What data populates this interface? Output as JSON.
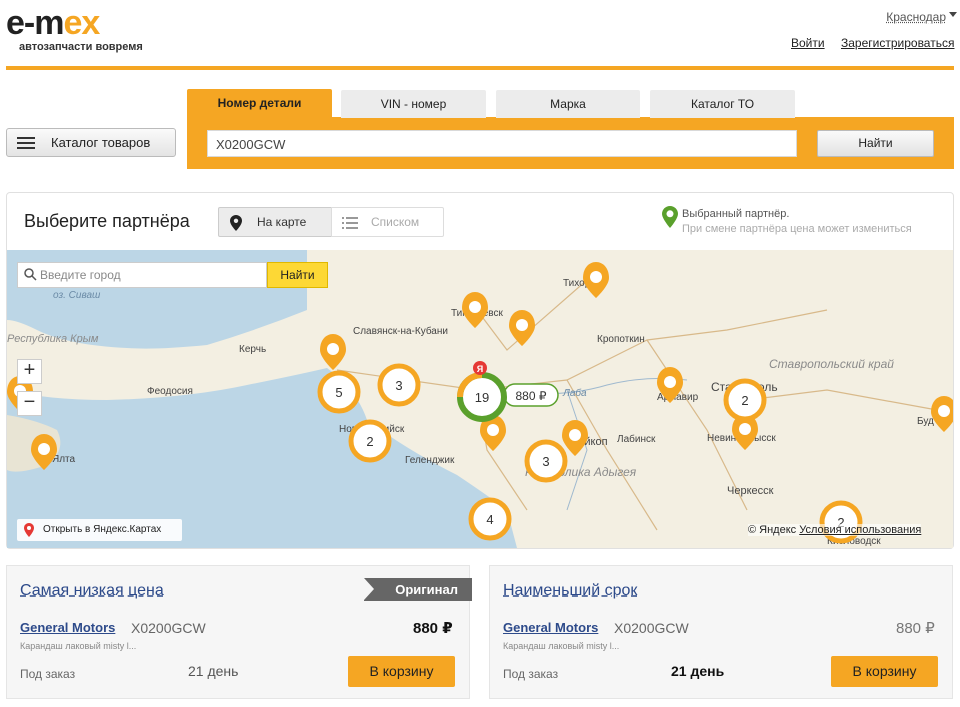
{
  "header": {
    "logo_left": "e-m",
    "logo_right": "ex",
    "tagline": "автозапчасти вовремя",
    "city": "Краснодар",
    "login": "Войти",
    "register": "Зарегистрироваться"
  },
  "catalog_button": "Каталог товаров",
  "search": {
    "tabs": [
      "Номер детали",
      "VIN - номер",
      "Марка",
      "Каталог ТО"
    ],
    "active_tab": "Номер детали",
    "value": "X0200GCW",
    "find": "Найти"
  },
  "partner": {
    "title": "Выберите партнёра",
    "view_map": "На карте",
    "view_list": "Списком",
    "selected_note": "Выбранный партнёр.",
    "price_note": "При смене партнёра цена может измениться"
  },
  "map": {
    "city_placeholder": "Введите город",
    "find": "Найти",
    "zoom_in": "+",
    "zoom_out": "−",
    "open_yandex": "Открыть в Яндекс.Картах",
    "copyright_prefix": "© Яндекс",
    "terms": "Условия использования",
    "selected_cluster": "19",
    "selected_price": "880 ₽",
    "clusters": [
      "5",
      "3",
      "2",
      "3",
      "4",
      "2",
      "2"
    ],
    "labels": [
      "оз. Сиваш",
      "Республика Крым",
      "Керчь",
      "Феодосия",
      "Ялта",
      "Славянск-на-Кубани",
      "Новороссийск",
      "Геленджик",
      "Кропоткин",
      "Лабинск",
      "Майкоп",
      "Республика Адыгея",
      "Ставрополь",
      "Ставропольский край",
      "Невинномысск",
      "Черкесск",
      "Армавир",
      "Тихорецк",
      "Тимашевск",
      "Лаба",
      "Кисловодск",
      "Буд"
    ]
  },
  "offers": [
    {
      "title": "Самая низкая цена",
      "badge": "Оригинал",
      "brand": "General Motors",
      "part": "X0200GCW",
      "price": "880 ₽",
      "description": "Карандаш лаковый misty l...",
      "availability": "Под заказ",
      "days": "21 день",
      "cart": "В корзину"
    },
    {
      "title": "Наименьший срок",
      "brand": "General Motors",
      "part": "X0200GCW",
      "price": "880 ₽",
      "description": "Карандаш лаковый misty l...",
      "availability": "Под заказ",
      "days": "21 день",
      "cart": "В корзину"
    }
  ],
  "colors": {
    "accent": "#f5a623",
    "link": "#2d4a8a",
    "selected": "#5aa02c"
  }
}
